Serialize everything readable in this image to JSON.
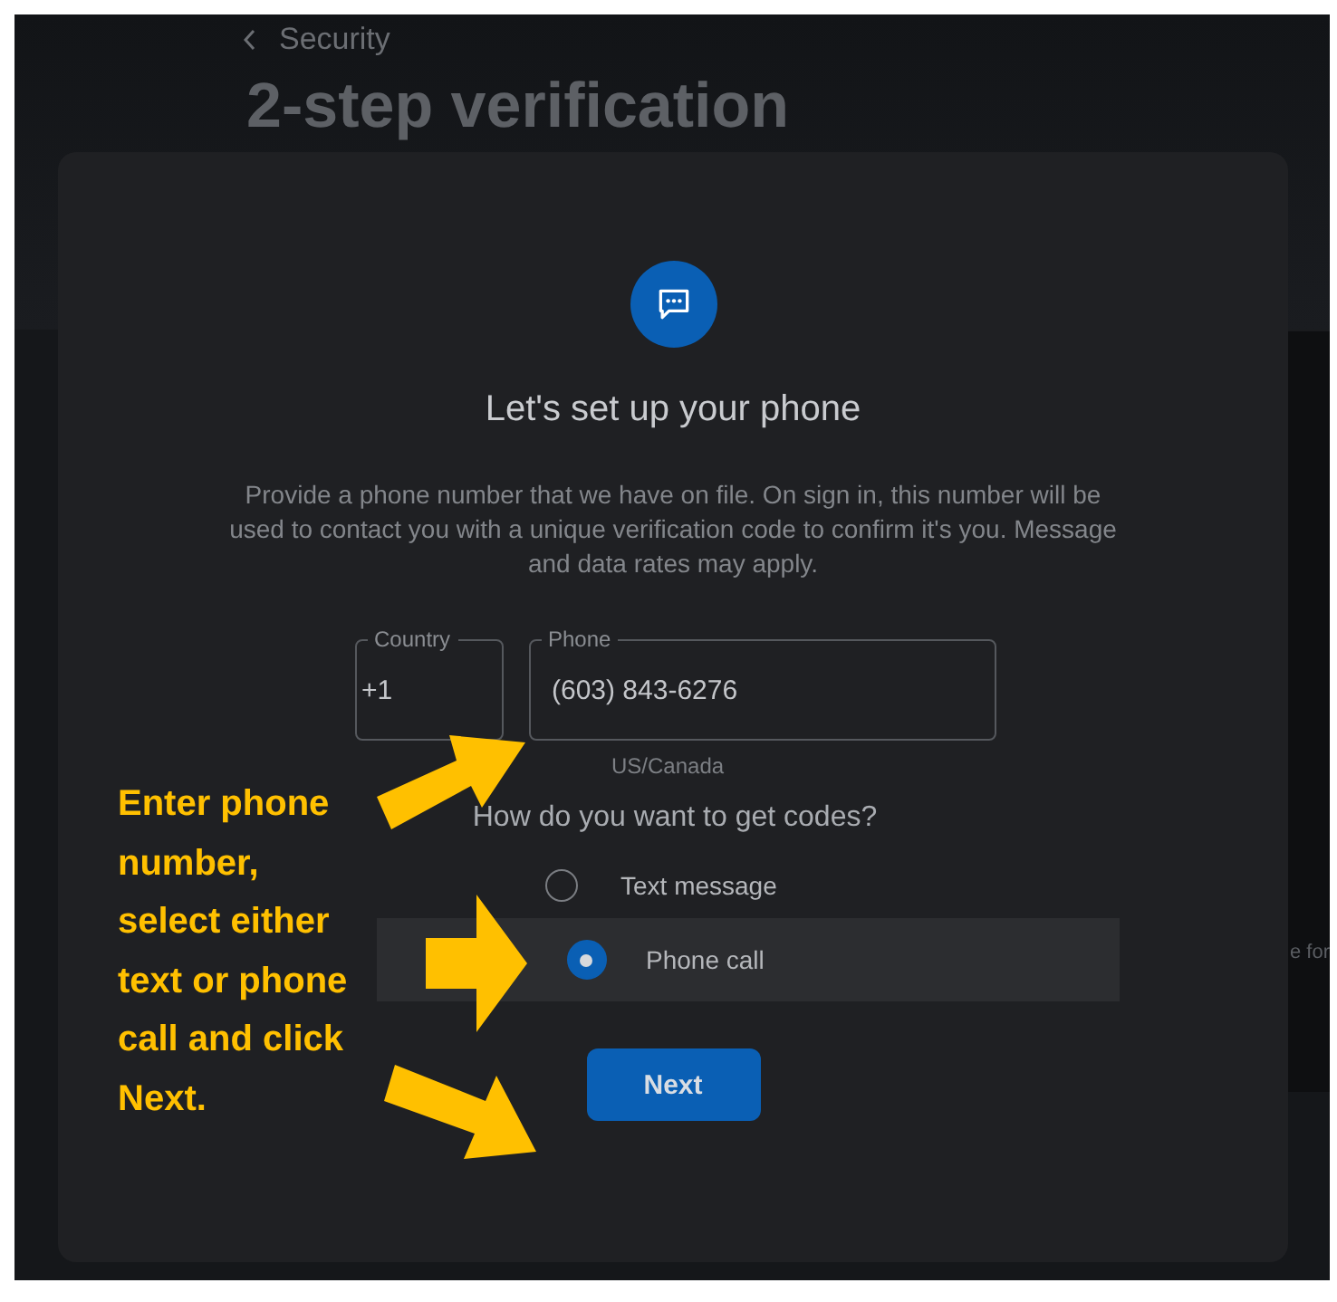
{
  "header": {
    "back_label": "Security",
    "title": "2-step verification"
  },
  "background_text": "e for",
  "dialog": {
    "heading": "Let's set up your phone",
    "description": "Provide a phone number that we have on file. On sign in, this number will be used to contact you with a unique verification code to confirm it's you. Message and data rates may apply.",
    "country_field": {
      "label": "Country",
      "value": "+1"
    },
    "phone_field": {
      "label": "Phone",
      "value": "(603) 843-6276",
      "hint": "US/Canada"
    },
    "question": "How do you want to get codes?",
    "options": [
      {
        "label": "Text message",
        "selected": false
      },
      {
        "label": "Phone call",
        "selected": true
      }
    ],
    "button": "Next"
  },
  "annotation": {
    "text": "Enter phone number, select either text or phone call and click Next."
  }
}
